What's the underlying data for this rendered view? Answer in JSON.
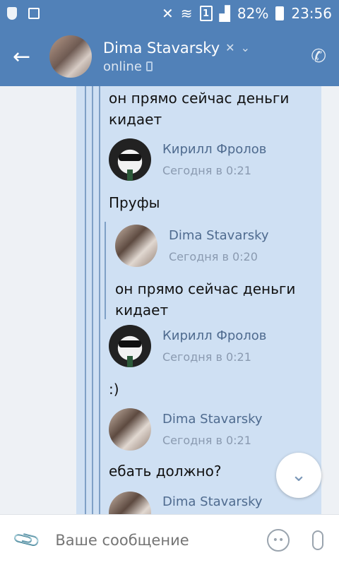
{
  "status_bar": {
    "battery": "82%",
    "time": "23:56",
    "sim_badge": "1"
  },
  "header": {
    "name": "Dima Stavarsky",
    "status": "online"
  },
  "messages": {
    "text_top": "он прямо сейчас деньги кидает",
    "q1_name": "Кирилл Фролов",
    "q1_date": "Сегодня в 0:21",
    "text_proofs": "Пруфы",
    "q2_name": "Dima Stavarsky",
    "q2_date": "Сегодня в 0:20",
    "q2_text": "он прямо сейчас деньги кидает",
    "q3_name": "Кирилл Фролов",
    "q3_date": "Сегодня в 0:21",
    "text_smile": ":)",
    "q4_name": "Dima Stavarsky",
    "q4_date": "Сегодня в 0:21",
    "text_last": "ебать должно?",
    "q5_name": "Dima Stavarsky"
  },
  "composer": {
    "placeholder": "Ваше сообщение"
  },
  "icons": {
    "back": "arrow-left-icon",
    "call": "phone-icon",
    "attach": "paperclip-icon",
    "emoji": "smile-icon",
    "mic": "microphone-icon",
    "scroll": "chevron-down-icon"
  },
  "colors": {
    "accent": "#5181b8",
    "bubble": "#cfe0f3",
    "author": "#4f6b8f"
  }
}
